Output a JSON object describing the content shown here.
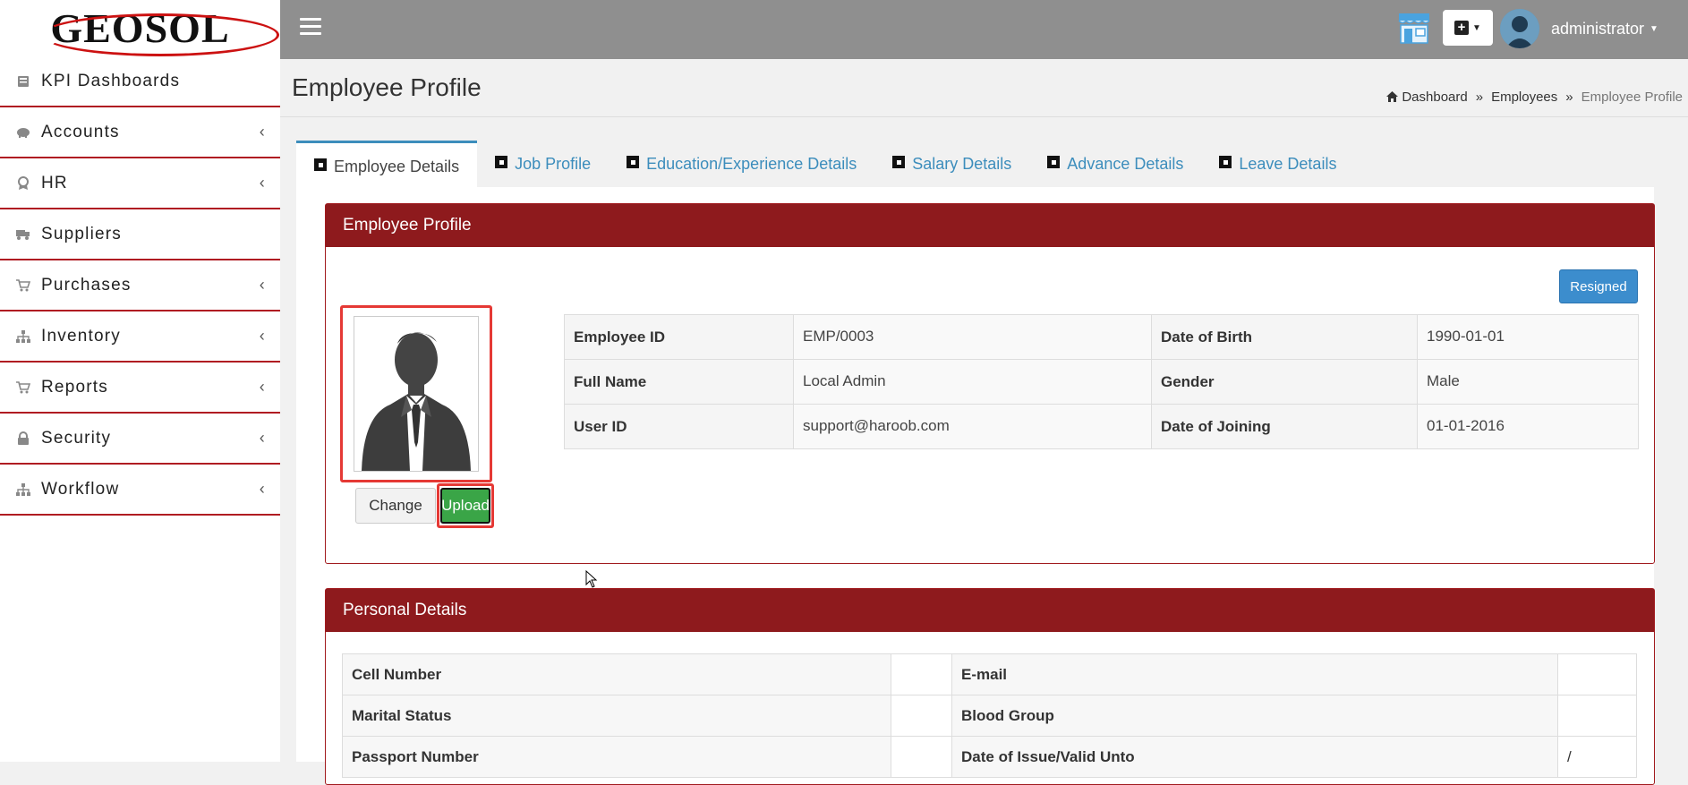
{
  "brand": {
    "logo_text": "GEOSOL",
    "accent_color": "#b01c22"
  },
  "sidebar": {
    "items": [
      {
        "label": "KPI Dashboards",
        "icon": "dashboard-icon",
        "has_submenu": false
      },
      {
        "label": "Accounts",
        "icon": "piggy-bank-icon",
        "has_submenu": true
      },
      {
        "label": "HR",
        "icon": "badge-icon",
        "has_submenu": true
      },
      {
        "label": "Suppliers",
        "icon": "truck-icon",
        "has_submenu": false
      },
      {
        "label": "Purchases",
        "icon": "cart-icon",
        "has_submenu": true
      },
      {
        "label": "Inventory",
        "icon": "sitemap-icon",
        "has_submenu": true
      },
      {
        "label": "Reports",
        "icon": "cart-icon",
        "has_submenu": true
      },
      {
        "label": "Security",
        "icon": "lock-icon",
        "has_submenu": true
      },
      {
        "label": "Workflow",
        "icon": "sitemap-icon",
        "has_submenu": true
      }
    ]
  },
  "topbar": {
    "user_name": "administrator"
  },
  "header": {
    "title": "Employee Profile",
    "breadcrumb": [
      "Dashboard",
      "Employees",
      "Employee Profile"
    ]
  },
  "tabs": [
    {
      "label": "Employee Details",
      "active": true
    },
    {
      "label": "Job Profile",
      "active": false
    },
    {
      "label": "Education/Experience Details",
      "active": false
    },
    {
      "label": "Salary Details",
      "active": false
    },
    {
      "label": "Advance Details",
      "active": false
    },
    {
      "label": "Leave Details",
      "active": false
    }
  ],
  "profile_panel": {
    "title": "Employee Profile",
    "status_button": "Resigned",
    "change_label": "Change",
    "upload_label": "Upload",
    "rows": [
      {
        "l1": "Employee ID",
        "v1": "EMP/0003",
        "l2": "Date of Birth",
        "v2": "1990-01-01"
      },
      {
        "l1": "Full Name",
        "v1": "Local Admin",
        "l2": "Gender",
        "v2": "Male"
      },
      {
        "l1": "User ID",
        "v1": "support@haroob.com",
        "l2": "Date of Joining",
        "v2": "01-01-2016"
      }
    ]
  },
  "personal_panel": {
    "title": "Personal Details",
    "rows": [
      {
        "l1": "Cell Number",
        "v1": "",
        "l2": "E-mail",
        "v2": ""
      },
      {
        "l1": "Marital Status",
        "v1": "",
        "l2": "Blood Group",
        "v2": ""
      },
      {
        "l1": "Passport Number",
        "v1": "",
        "l2": "Date of Issue/Valid Unto",
        "v2": "/"
      }
    ]
  }
}
